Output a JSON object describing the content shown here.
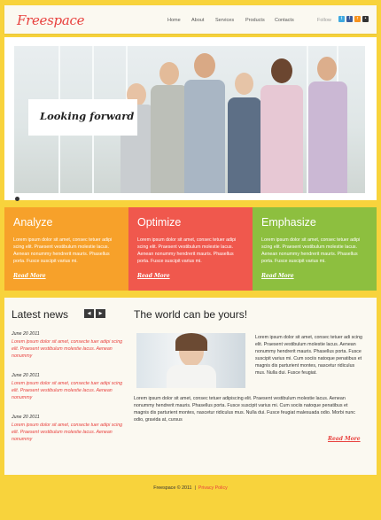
{
  "header": {
    "logo": "Freespace",
    "nav": [
      "Home",
      "About",
      "Services",
      "Products",
      "Contacts"
    ],
    "social_label": "Follow",
    "social_icons": [
      "twitter-icon",
      "facebook-icon",
      "rss-icon",
      "flickr-icon"
    ]
  },
  "hero": {
    "slogan": "Looking forward"
  },
  "features": [
    {
      "title": "Analyze",
      "text": "Lorem ipsum dolor sit amet, consec tetuer adipi scing elit. Praesent vestibulum molestie lacus. Aenean nonummy hendrerit mauris. Phasellus porta. Fusce suscipit varius mi.",
      "more": "Read More",
      "color": "#f7a12a"
    },
    {
      "title": "Optimize",
      "text": "Lorem ipsum dolor sit amet, consec tetuer adipi scing elit. Praesent vestibulum molestie lacus. Aenean nonummy hendrerit mauris. Phasellus porta. Fusce suscipit varius mi.",
      "more": "Read More",
      "color": "#f0584d"
    },
    {
      "title": "Emphasize",
      "text": "Lorem ipsum dolor sit amet, consec tetuer adipi scing elit. Praesent vestibulum molestie lacus. Aenean nonummy hendrerit mauris. Phasellus porta. Fusce suscipit varius mi.",
      "more": "Read More",
      "color": "#8dbf3f"
    }
  ],
  "news": {
    "title": "Latest news",
    "items": [
      {
        "date": "June 20 2011",
        "text": "Lorem ipsum dolor sit amet, consecte tuer adipi scing elit. Praesent vestibulum molestie lacus. Aenean nonummy"
      },
      {
        "date": "June 20 2011",
        "text": "Lorem ipsum dolor sit amet, consecte tuer adipi scing elit. Praesent vestibulum molestie lacus. Aenean nonummy"
      },
      {
        "date": "June 20 2011",
        "text": "Lorem ipsum dolor sit amet, consecte tuer adipi scing elit. Praesent vestibulum molestie lacus. Aenean nonummy"
      }
    ]
  },
  "world": {
    "title": "The world can be yours!",
    "side_text": "Lorem ipsum dolor sit amet, consec tetuer adi scing elit. Praesent vestibulum molestie lacus. Aenean nonummy hendrerit mauris. Phasellus porta. Fusce suscipit varius mi. Cum sociis natoque penatibus et magnis dis parturient montes, nascetur ridiculus mus. Nulla dui. Fusce feugiat.",
    "full_text": "Lorem ipsum dolor sit amet, consec tetuer adipiscing elit. Praesent vestibulum molestie lacus. Aenean nonummy hendrerit mauris. Phasellus porta. Fusce suscipit varius mi. Cum sociis natoque penatibus et magnis dis parturient montes, nascetur ridiculus mus. Nulla dui. Fusce feugiat malesuada odio. Morbi nunc odio, gravida at, cursus",
    "more": "Read More"
  },
  "footer": {
    "copyright": "Freespace © 2011",
    "privacy": "Privacy Policy"
  }
}
